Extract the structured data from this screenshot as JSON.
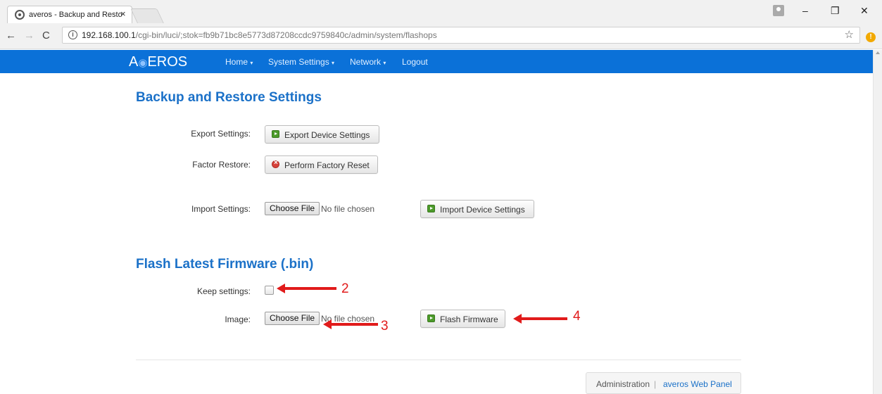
{
  "browser": {
    "tab_title": "averos - Backup and Resto",
    "tab_close": "×",
    "url_host": "192.168.100.1",
    "url_path": "/cgi-bin/luci/;stok=fb9b71bc8e5773d87208ccdc9759840c/admin/system/flashops",
    "minimize": "–",
    "restore": "❐",
    "close": "✕",
    "star": "☆",
    "ext_badge": "!"
  },
  "navbar": {
    "brand_a": "A",
    "brand_rest": "EROS",
    "items": [
      {
        "label": "Home"
      },
      {
        "label": "System Settings"
      },
      {
        "label": "Network"
      },
      {
        "label": "Logout"
      }
    ],
    "caret": "▾"
  },
  "backup": {
    "title": "Backup and Restore Settings",
    "export_label": "Export Settings:",
    "export_button": "Export Device Settings",
    "factory_label": "Factor Restore:",
    "factory_button": "Perform Factory Reset",
    "import_label": "Import Settings:",
    "choose_file": "Choose File",
    "no_file": "No file chosen",
    "import_button": "Import Device Settings"
  },
  "flash": {
    "title": "Flash Latest Firmware (.bin)",
    "keep_label": "Keep settings:",
    "keep_checked": false,
    "image_label": "Image:",
    "choose_file": "Choose File",
    "no_file": "No file chosen",
    "flash_button": "Flash Firmware"
  },
  "annotations": [
    "2",
    "3",
    "4"
  ],
  "footer": {
    "admin": "Administration",
    "separator": "|",
    "panel": "averos Web Panel"
  },
  "colors": {
    "navbar": "#0b71d8",
    "heading": "#1b71c8",
    "annotation": "#e11b1b"
  }
}
